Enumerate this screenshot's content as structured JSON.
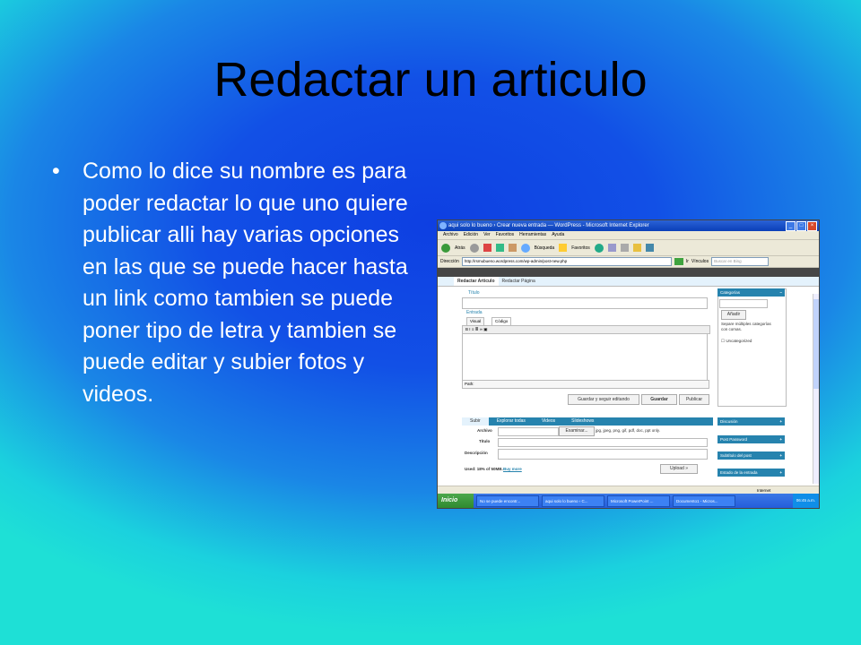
{
  "slide": {
    "title": "Redactar un articulo",
    "bullet": "Como lo dice su nombre es para poder redactar lo que uno quiere publicar alli hay varias opciones en las que se puede hacer hasta un link como tambien se puede poner tipo de letra y tambien se puede editar y subier fotos y videos."
  },
  "screenshot": {
    "window_title": "aqui solo lo bueno › Crear nueva entrada — WordPress - Microsoft Internet Explorer",
    "menu": [
      "Archivo",
      "Edición",
      "Ver",
      "Favoritos",
      "Herramientas",
      "Ayuda"
    ],
    "toolbar": {
      "back": "Atrás",
      "search": "Búsqueda",
      "favorites": "Favoritos"
    },
    "address_label": "Dirección",
    "address_url": "http://rsmubueno.wordpress.com/wp-admin/post-new.php",
    "go_label": "Ir",
    "links_label": "Vínculos",
    "search_placeholder": "Buscar en Bing",
    "tabs": [
      "Redactar Articulo",
      "Redactar Página"
    ],
    "titulo_label": "Título",
    "entrada_label": "Entrada",
    "editor_tabs": [
      "Visual",
      "Código"
    ],
    "path_label": "Path:",
    "buttons": {
      "save_continue": "Guardar y seguir editando",
      "save": "Guardar",
      "publish": "Publicar"
    },
    "categorias": {
      "title": "Categorías",
      "add": "Añadir",
      "hint": "Separe múltiples categorías con comas.",
      "uncategorized": "Uncategorized"
    },
    "upload_tabs": [
      "Subir",
      "Explorar todas",
      "Videos",
      "Slideshows"
    ],
    "upload": {
      "archivo": "Archivo",
      "examinar": "Examinar...",
      "formats": "jpg, jpeg, png, gif, pdf, doc, ppt only.",
      "titulo": "Título",
      "descripcion": "Descripción",
      "used": "Used: 18% of 50MB.",
      "buy_more": "Buy more",
      "upload_btn": "Upload »"
    },
    "side_panels": [
      "Discusión",
      "Post Password",
      "Subtítulo del post",
      "Estado de la entrada"
    ],
    "status": "Internet",
    "taskbar": {
      "start": "Inicio",
      "tasks": [
        "No se puede encontr...",
        "aqui solo lo bueno › C...",
        "Microsoft PowerPoint ...",
        "Documento1 - Micros..."
      ],
      "clock": "06:45 a.m."
    }
  }
}
